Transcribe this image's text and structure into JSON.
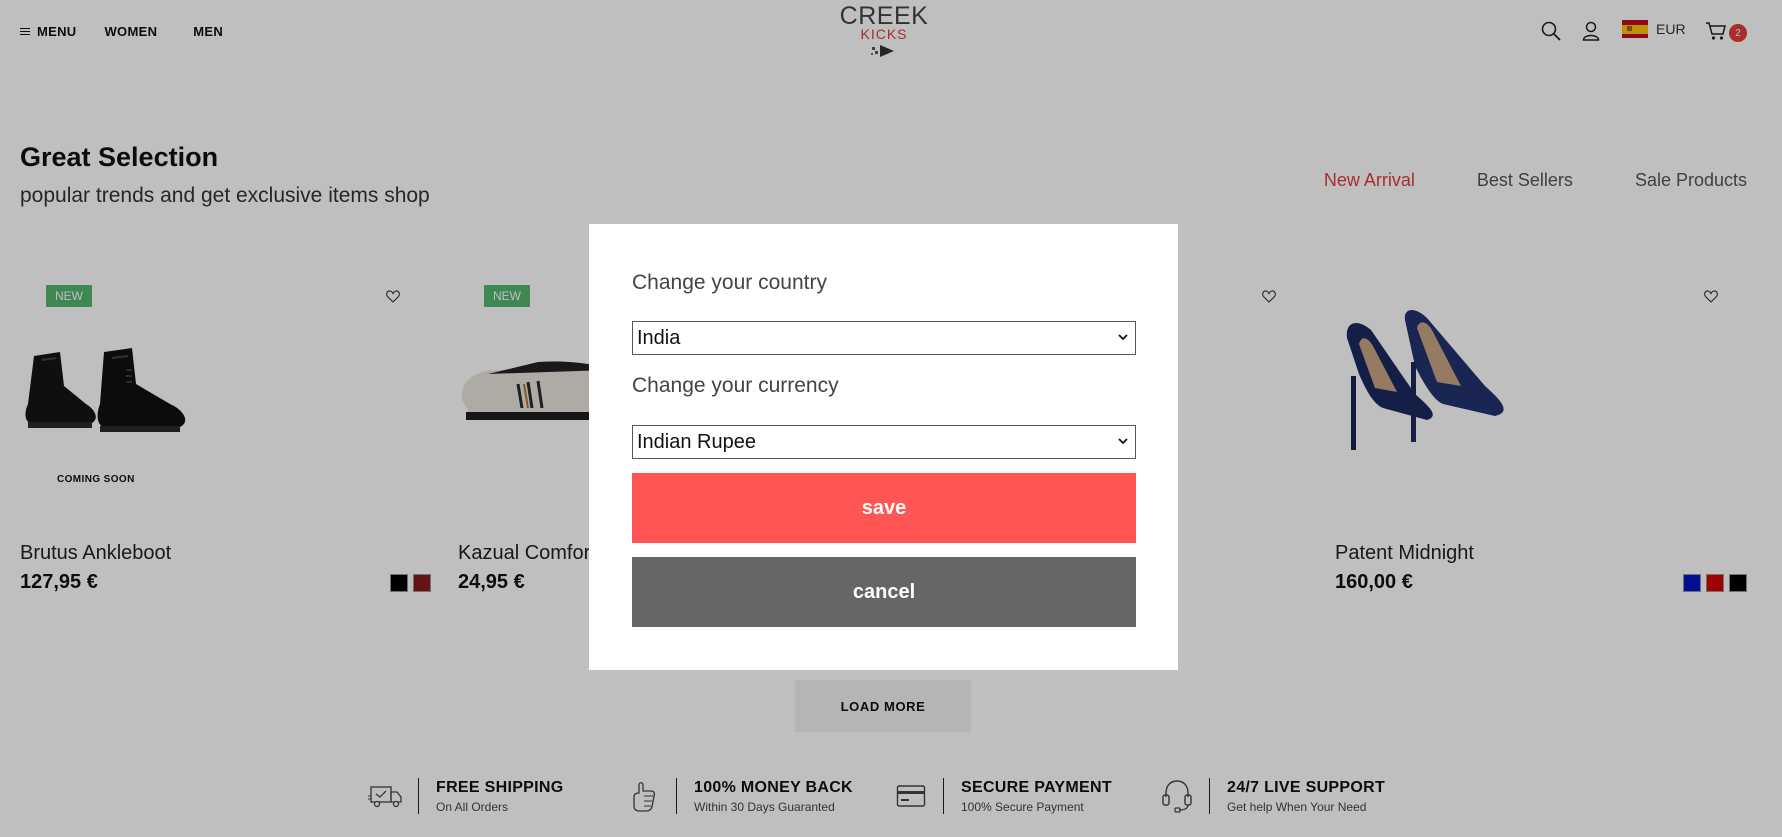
{
  "header": {
    "menu_label": "MENU",
    "nav": [
      "WOMEN",
      "MEN"
    ],
    "logo": {
      "main": "CREEK",
      "sub": "KICKS"
    },
    "currency": "EUR",
    "cart_count": "2"
  },
  "section": {
    "title": "Great Selection",
    "subtitle": "popular trends and get exclusive items shop",
    "tabs": [
      "New Arrival",
      "Best Sellers",
      "Sale Products"
    ],
    "active_tab": "New Arrival"
  },
  "products": [
    {
      "name": "Brutus Ankleboot",
      "price": "127,95 €",
      "badge": "NEW",
      "overlay_text": "COMING SOON",
      "swatches": [
        "#000000",
        "#8b1a1a"
      ]
    },
    {
      "name": "Kazual Comfor",
      "price": "24,95 €",
      "badge": "NEW"
    },
    {
      "name": "Patent Midnight",
      "price": "160,00 €",
      "swatches": [
        "#0014c8",
        "#d40000",
        "#000000"
      ]
    }
  ],
  "load_more": "LOAD MORE",
  "features": [
    {
      "title": "FREE SHIPPING",
      "subtitle": "On All Orders",
      "icon": "truck-icon"
    },
    {
      "title": "100% MONEY BACK",
      "subtitle": "Within 30 Days Guaranted",
      "icon": "thumbs-up-icon"
    },
    {
      "title": "SECURE PAYMENT",
      "subtitle": "100% Secure Payment",
      "icon": "credit-card-icon"
    },
    {
      "title": "24/7 LIVE SUPPORT",
      "subtitle": "Get help When Your Need",
      "icon": "headset-icon"
    }
  ],
  "modal": {
    "country_label": "Change your country",
    "country_value": "India",
    "currency_label": "Change your currency",
    "currency_value": "Indian Rupee",
    "save_label": "save",
    "cancel_label": "cancel"
  },
  "colors": {
    "accent": "#e13c3c",
    "save_button": "#ff5555",
    "cancel_button": "#666666",
    "new_badge": "#55b46f"
  }
}
